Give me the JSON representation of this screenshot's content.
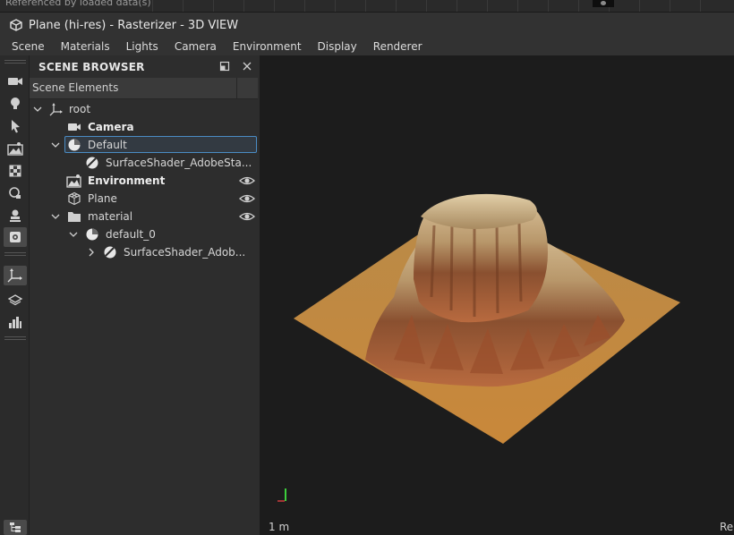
{
  "top_strip": {
    "text": "Referenced by loaded data(s)"
  },
  "window": {
    "title": "Plane (hi-res) - Rasterizer - 3D VIEW"
  },
  "menu": [
    "Scene",
    "Materials",
    "Lights",
    "Camera",
    "Environment",
    "Display",
    "Renderer"
  ],
  "toolbar": {
    "tools": [
      "camera-tool",
      "light-tool",
      "select-tool",
      "environment-tool",
      "material-tool",
      "shape-tool",
      "stamp-tool",
      "settings-tool",
      "axis-tool",
      "layers-tool",
      "stats-tool"
    ],
    "active_tool": "settings-tool"
  },
  "scene_browser": {
    "title": "SCENE BROWSER",
    "column_header": "Scene Elements",
    "selected_item": "Default",
    "items": [
      {
        "label": "root",
        "depth": 0,
        "expanded": true,
        "icon": "axis-icon"
      },
      {
        "label": "Camera",
        "depth": 1,
        "bold": true,
        "icon": "camera-icon"
      },
      {
        "label": "Default",
        "depth": 1,
        "expanded": true,
        "icon": "sphere-icon",
        "selected": true
      },
      {
        "label": "SurfaceShader_AdobeSta...",
        "depth": 2,
        "icon": "shader-icon"
      },
      {
        "label": "Environment",
        "depth": 1,
        "bold": true,
        "icon": "environment-icon",
        "visible": true
      },
      {
        "label": "Plane",
        "depth": 1,
        "icon": "mesh-icon",
        "visible": true
      },
      {
        "label": "material",
        "depth": 1,
        "expanded": true,
        "icon": "folder-icon",
        "visible": true
      },
      {
        "label": "default_0",
        "depth": 2,
        "expanded": true,
        "icon": "sphere-icon"
      },
      {
        "label": "SurfaceShader_Adob...",
        "depth": 3,
        "collapsed": true,
        "icon": "shader-icon"
      }
    ]
  },
  "viewport": {
    "scale_label": "1 m",
    "right_label": "Ren",
    "colors": {
      "background": "#1c1c1c",
      "plane": "#b97a3a",
      "rock_light": "#cdb48a",
      "rock_dark": "#7a3f22"
    }
  }
}
